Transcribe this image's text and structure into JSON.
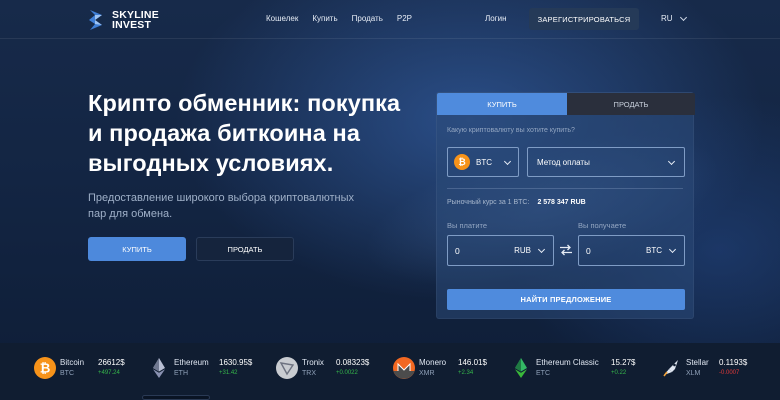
{
  "header": {
    "logo_line1": "SKYLINE",
    "logo_line2": "INVEST",
    "nav": [
      "Кошелек",
      "Купить",
      "Продать",
      "P2P"
    ],
    "login": "Логин",
    "register": "ЗАРЕГИСТРИРОВАТЬСЯ",
    "lang": "RU"
  },
  "hero": {
    "title": "Крипто обменник: покупка и продажа биткоина на выгодных условиях.",
    "subtitle": "Предоставление широкого выбора криптовалютных пар для обмена.",
    "buy_label": "КУПИТЬ",
    "sell_label": "ПРОДАТЬ"
  },
  "exchange": {
    "tab_buy": "КУПИТЬ",
    "tab_sell": "ПРОДАТЬ",
    "question": "Какую криптовалюту вы хотите купить?",
    "coin": "BTC",
    "method_placeholder": "Метод оплаты",
    "rate_label": "Рыночный курс за 1 BTC:",
    "rate_value": "2 578 347 RUB",
    "pay_label": "Вы платите",
    "get_label": "Вы получаете",
    "pay_value": "0",
    "pay_currency": "RUB",
    "get_value": "0",
    "get_currency": "BTC",
    "find_label": "НАЙТИ ПРЕДЛОЖЕНИЕ"
  },
  "ticker": [
    {
      "name": "Bitcoin",
      "symbol": "BTC",
      "price": "26612$",
      "change": "+497.24",
      "dir": "up",
      "icon": "bitcoin-icon",
      "color": "#f7931a"
    },
    {
      "name": "Ethereum",
      "symbol": "ETH",
      "price": "1630.95$",
      "change": "+31.42",
      "dir": "up",
      "icon": "ethereum-icon",
      "color": "#8a92b2"
    },
    {
      "name": "Tronix",
      "symbol": "TRX",
      "price": "0.08323$",
      "change": "+0.0022",
      "dir": "up",
      "icon": "tron-icon",
      "color": "#c9ccd1"
    },
    {
      "name": "Monero",
      "symbol": "XMR",
      "price": "146.01$",
      "change": "+2.34",
      "dir": "up",
      "icon": "monero-icon",
      "color": "#f26822"
    },
    {
      "name": "Ethereum Classic",
      "symbol": "ETC",
      "price": "15.27$",
      "change": "+0.22",
      "dir": "up",
      "icon": "ethereum-classic-icon",
      "color": "#33b865"
    },
    {
      "name": "Stellar",
      "symbol": "XLM",
      "price": "0.1193$",
      "change": "-0.0007",
      "dir": "down",
      "icon": "stellar-icon",
      "color": "#dfe6f1"
    }
  ]
}
